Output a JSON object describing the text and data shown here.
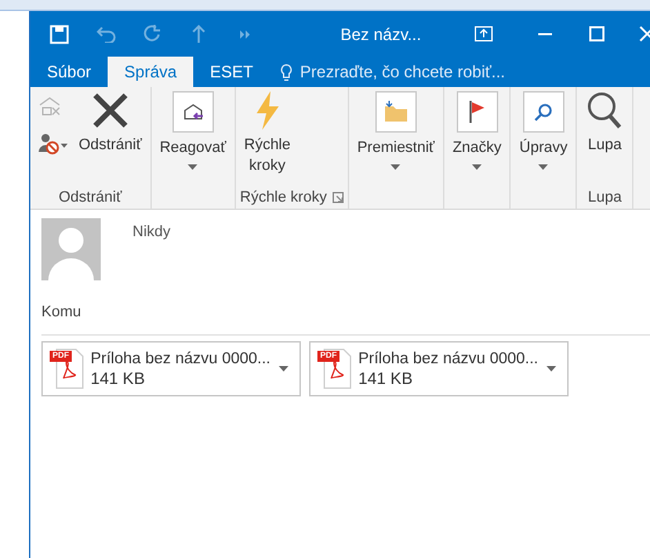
{
  "window": {
    "title": "Bez názv..."
  },
  "tabs": [
    {
      "label": "Súbor",
      "selected": false
    },
    {
      "label": "Správa",
      "selected": true
    },
    {
      "label": "ESET",
      "selected": false
    }
  ],
  "tell_me": {
    "placeholder": "Prezraďte, čo chcete robiť..."
  },
  "ribbon": {
    "groups": [
      {
        "label": "Odstrániť",
        "buttons": [
          {
            "kind": "delete",
            "label": "Odstrániť"
          }
        ]
      },
      {
        "buttons": [
          {
            "kind": "reply",
            "label": "Reagovať"
          }
        ]
      },
      {
        "label": "Rýchle kroky",
        "launcher": true,
        "buttons": [
          {
            "kind": "quick",
            "label": "Rýchle kroky"
          }
        ]
      },
      {
        "buttons": [
          {
            "kind": "move",
            "label": "Premiestniť"
          }
        ]
      },
      {
        "buttons": [
          {
            "kind": "tags",
            "label": "Značky"
          }
        ]
      },
      {
        "buttons": [
          {
            "kind": "edit",
            "label": "Úpravy"
          }
        ]
      },
      {
        "label": "Lupa",
        "buttons": [
          {
            "kind": "zoom",
            "label": "Lupa"
          }
        ]
      }
    ]
  },
  "message": {
    "sent": "Nikdy",
    "to_label": "Komu"
  },
  "attachments": [
    {
      "badge": "PDF",
      "name": "Príloha bez názvu 0000...",
      "size": "141 KB"
    },
    {
      "badge": "PDF",
      "name": "Príloha bez názvu 0000...",
      "size": "141 KB"
    }
  ]
}
